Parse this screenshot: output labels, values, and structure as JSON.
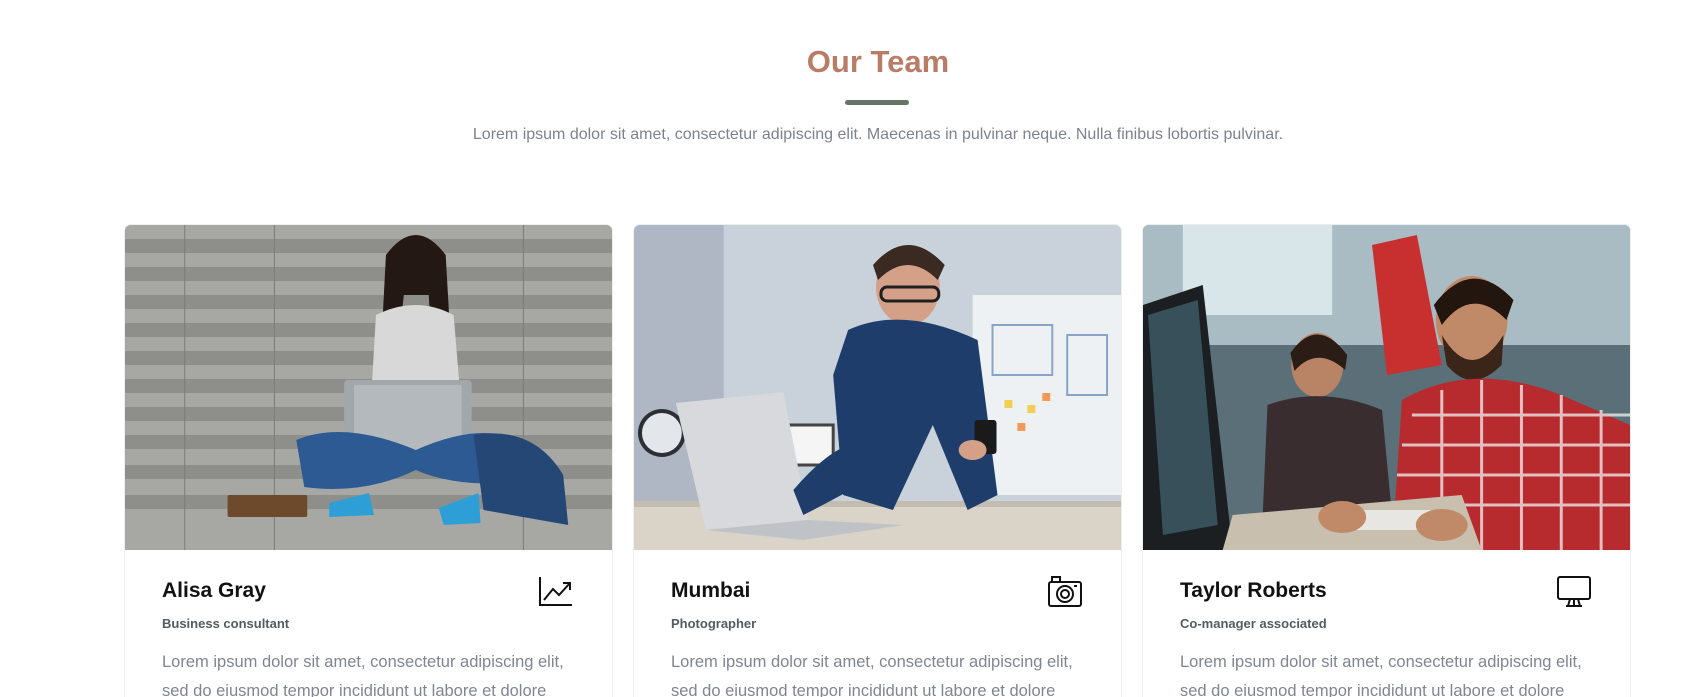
{
  "header": {
    "title": "Our Team",
    "subtitle": "Lorem ipsum dolor sit amet, consectetur adipiscing elit. Maecenas in pulvinar neque. Nulla finibus lobortis pulvinar."
  },
  "colors": {
    "title": "#b97d67",
    "accent_bar": "#677567",
    "body_text": "#808592"
  },
  "team": [
    {
      "name": "Alisa Gray",
      "role": "Business consultant",
      "description": "Lorem ipsum dolor sit amet, consectetur adipiscing elit, sed do eiusmod tempor incididunt ut labore et dolore",
      "icon": "chart-trend-icon"
    },
    {
      "name": "Mumbai",
      "role": "Photographer",
      "description": "Lorem ipsum dolor sit amet, consectetur adipiscing elit, sed do eiusmod tempor incididunt ut labore et dolore",
      "icon": "camera-icon"
    },
    {
      "name": "Taylor Roberts",
      "role": "Co-manager associated",
      "description": "Lorem ipsum dolor sit amet, consectetur adipiscing elit, sed do eiusmod tempor incididunt ut labore et dolore",
      "icon": "monitor-icon"
    }
  ]
}
